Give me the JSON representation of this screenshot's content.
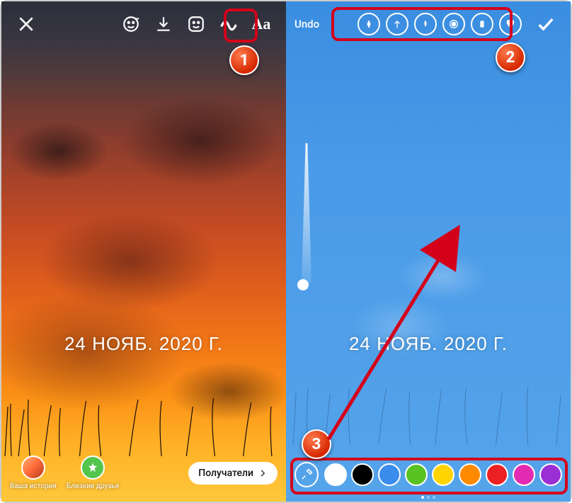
{
  "left": {
    "date_text": "24 НОЯБ. 2020 Г.",
    "toolbar": {
      "close": "Close",
      "face": "Face filter",
      "download": "Download",
      "sticker": "Stickers",
      "draw": "Draw",
      "text_label": "Aa"
    },
    "bottom": {
      "your_story": "Ваша история",
      "close_friends": "Близкие друзья",
      "recipients": "Получатели"
    }
  },
  "right": {
    "undo_label": "Undo",
    "date_text": "24 НОЯБ. 2020 Г.",
    "brushes": {
      "pen": "pen-brush",
      "arrow": "arrow-brush",
      "marker": "marker-brush",
      "neon": "neon-brush",
      "eraser": "eraser-brush",
      "heart": "heart-brush"
    },
    "palette": {
      "eyedropper": "eyedropper",
      "colors": [
        {
          "name": "white",
          "hex": "#ffffff",
          "selected": true
        },
        {
          "name": "black",
          "hex": "#000000"
        },
        {
          "name": "blue",
          "hex": "#3b8ded"
        },
        {
          "name": "green",
          "hex": "#58c322"
        },
        {
          "name": "yellow",
          "hex": "#ffd400"
        },
        {
          "name": "orange",
          "hex": "#ff8a00"
        },
        {
          "name": "red",
          "hex": "#ed2024"
        },
        {
          "name": "magenta",
          "hex": "#e22bb0"
        },
        {
          "name": "purple",
          "hex": "#9b2fd6"
        }
      ]
    }
  },
  "callouts": {
    "one": "1",
    "two": "2",
    "three": "3"
  }
}
